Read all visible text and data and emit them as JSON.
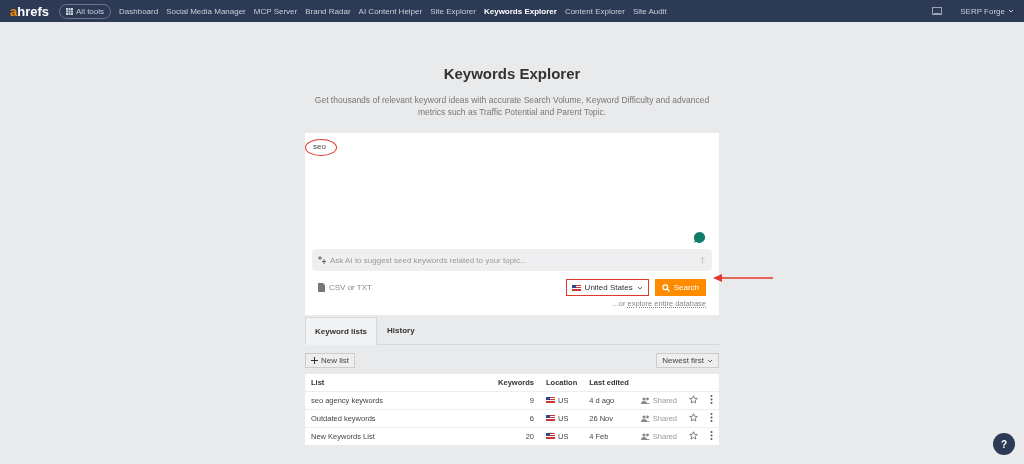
{
  "nav": {
    "logo": "ahrefs",
    "all_tools": "All tools",
    "items": [
      {
        "label": "Dashboard",
        "selected": false
      },
      {
        "label": "Social Media Manager",
        "selected": false
      },
      {
        "label": "MCP Server",
        "selected": false
      },
      {
        "label": "Brand Radar",
        "selected": false
      },
      {
        "label": "AI Content Helper",
        "selected": false
      },
      {
        "label": "Site Explorer",
        "selected": false
      },
      {
        "label": "Keywords Explorer",
        "selected": true
      },
      {
        "label": "Content Explorer",
        "selected": false
      },
      {
        "label": "Site Audit",
        "selected": false
      }
    ],
    "account": "SERP Forge"
  },
  "page": {
    "title": "Keywords Explorer",
    "subtitle": "Get thousands of relevant keyword ideas with accurate Search Volume, Keyword Difficulty and advanced metrics such as Traffic Potential and Parent Topic."
  },
  "search_card": {
    "value": "seo",
    "ai_placeholder": "Ask AI to suggest seed keywords related to your topic...",
    "upload": "CSV or TXT",
    "country": "United States",
    "search_button": "Search",
    "explore_prefix": "...or ",
    "explore_link": "explore entire database"
  },
  "tabs": [
    {
      "label": "Keyword lists",
      "selected": true
    },
    {
      "label": "History",
      "selected": false
    }
  ],
  "new_list": "New list",
  "sort": "Newest first",
  "table": {
    "columns": [
      "List",
      "Keywords",
      "Location",
      "Last edited"
    ],
    "rows": [
      {
        "name": "seo agency keywords",
        "keywords": "9",
        "location": "US",
        "last_edited": "4 d ago",
        "sharing": "Shared"
      },
      {
        "name": "Outdated keywords",
        "keywords": "6",
        "location": "US",
        "last_edited": "26 Nov",
        "sharing": "Shared"
      },
      {
        "name": "New Keywords List",
        "keywords": "20",
        "location": "US",
        "last_edited": "4 Feb",
        "sharing": "Shared"
      }
    ]
  },
  "help": "?"
}
